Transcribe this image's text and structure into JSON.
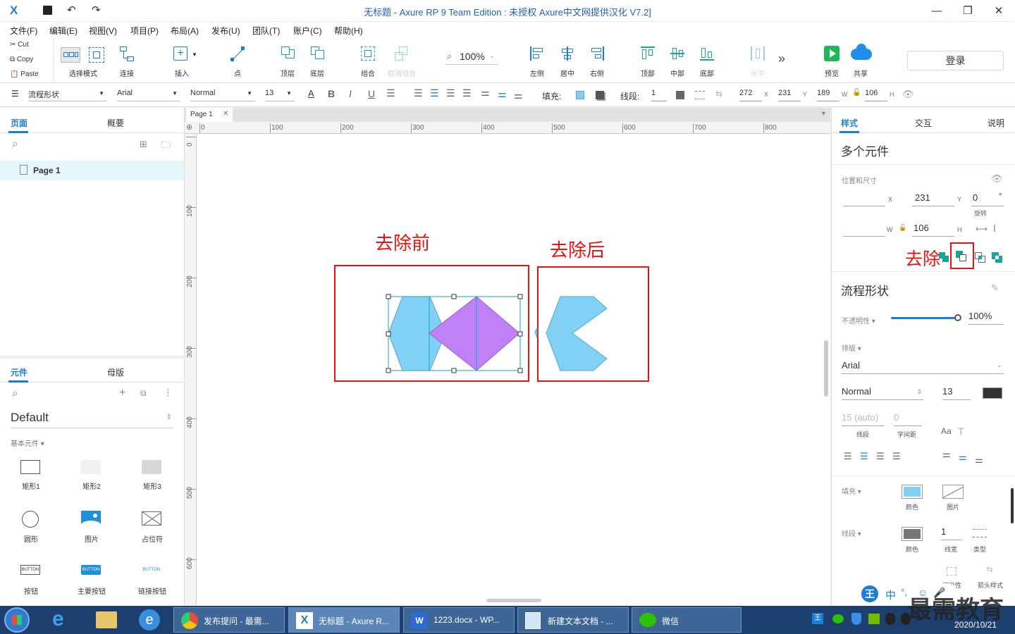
{
  "window": {
    "title": "无标题 - Axure RP 9 Team Edition : 未授权      Axure中文网提供汉化 V7.2]"
  },
  "menu": [
    "文件(F)",
    "编辑(E)",
    "视图(V)",
    "项目(P)",
    "布局(A)",
    "发布(U)",
    "团队(T)",
    "账户(C)",
    "帮助(H)"
  ],
  "clipboard": {
    "cut": "Cut",
    "copy": "Copy",
    "paste": "Paste"
  },
  "toolbar": {
    "select_mode": "选择模式",
    "connect": "连接",
    "insert": "插入",
    "point": "点",
    "top_layer": "顶层",
    "bottom_layer": "底层",
    "group": "组合",
    "ungroup": "取消组合",
    "zoom": "100%",
    "align_left": "左侧",
    "align_center": "居中",
    "align_right": "右侧",
    "align_top": "顶部",
    "align_middle": "中部",
    "align_bottom": "底部",
    "distribute_h": "水平",
    "preview": "预览",
    "share": "共享",
    "login": "登录"
  },
  "formatbar": {
    "style": "流程形状",
    "font": "Arial",
    "weight": "Normal",
    "size": "13",
    "fill_label": "填充:",
    "stroke_label": "线段:",
    "stroke_value": "1",
    "x": "272",
    "y": "231",
    "w": "189",
    "h": "106",
    "x_lbl": "X",
    "y_lbl": "Y",
    "w_lbl": "W",
    "h_lbl": "H"
  },
  "pages_panel": {
    "tab_pages": "页面",
    "tab_outline": "概要",
    "page1": "Page 1"
  },
  "widgets_panel": {
    "tab_widgets": "元件",
    "tab_masters": "母版",
    "library": "Default",
    "category": "基本元件 ▾",
    "items": [
      {
        "label": "矩形1"
      },
      {
        "label": "矩形2"
      },
      {
        "label": "矩形3"
      },
      {
        "label": "圆形"
      },
      {
        "label": "图片"
      },
      {
        "label": "占位符"
      },
      {
        "label": "按钮"
      },
      {
        "label": "主要按钮"
      },
      {
        "label": "链接按钮"
      }
    ],
    "btn_text": "BUTTON"
  },
  "canvas": {
    "tab": "Page 1",
    "ruler_top": [
      "0",
      "100",
      "200",
      "300",
      "400",
      "500",
      "600",
      "700",
      "800"
    ],
    "ruler_left": [
      "0",
      "100",
      "200",
      "300",
      "400",
      "500",
      "600"
    ],
    "before_label": "去除前",
    "after_label": "去除后"
  },
  "inspector": {
    "tab_style": "样式",
    "tab_interact": "交互",
    "tab_notes": "说明",
    "selection_title": "多个元件",
    "pos_size_label": "位置和尺寸",
    "x_value": "231",
    "y_value": "0",
    "degree": "°",
    "rotate_label": "旋转",
    "w_value": "106",
    "remove_label": "去除",
    "shape_title": "流程形状",
    "opacity_label": "不透明性 ▾",
    "opacity_value": "100%",
    "typography_label": "排版 ▾",
    "font": "Arial",
    "weight": "Normal",
    "size": "13",
    "line_height": "15 (auto)",
    "line_height_label": "线段",
    "letter_spacing": "0",
    "letter_spacing_label": "字间距",
    "fill_label": "填充 ▾",
    "fill_color_label": "颜色",
    "fill_image_label": "图片",
    "stroke_label": "线段 ▾",
    "stroke_color_label": "颜色",
    "stroke_width": "1",
    "stroke_width_label": "线宽",
    "stroke_type_label": "类型",
    "visible_label": "可见性",
    "arrow_label": "箭头样式"
  },
  "taskbar": {
    "items": [
      "发布提问 - 最需...",
      "无标题 - Axure R...",
      "1223.docx - WP...",
      "新建文本文档 - ...",
      "微信"
    ],
    "ime": "中",
    "date": "2020/10/21",
    "watermark": "最需教育"
  },
  "colors": {
    "shape_blue": "#81d0f5",
    "shape_purple": "#c081f7",
    "accent": "#1a7ed6",
    "annotation_red": "#e11111",
    "preview_green": "#1db954",
    "share_blue": "#1d8fe8"
  }
}
